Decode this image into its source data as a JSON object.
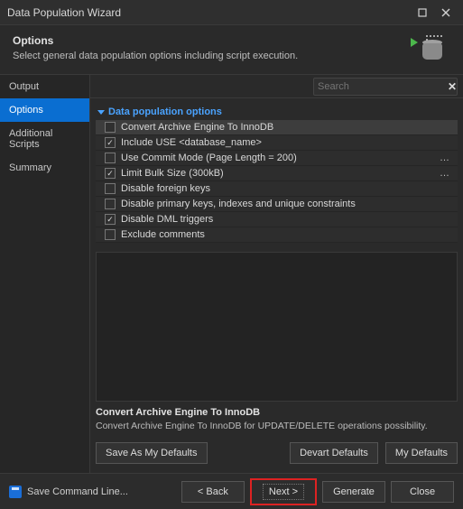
{
  "title": "Data Population Wizard",
  "header": {
    "title": "Options",
    "subtitle": "Select general data population options including script execution."
  },
  "sidebar": {
    "items": [
      {
        "label": "Output"
      },
      {
        "label": "Options"
      },
      {
        "label": "Additional Scripts"
      },
      {
        "label": "Summary"
      }
    ]
  },
  "search": {
    "placeholder": "Search"
  },
  "section_title": "Data population options",
  "options": [
    {
      "label": "Convert Archive Engine To InnoDB",
      "checked": false,
      "highlight": true,
      "ellipsis": false
    },
    {
      "label": "Include USE <database_name>",
      "checked": true,
      "highlight": false,
      "ellipsis": false
    },
    {
      "label": "Use Commit Mode (Page Length = 200)",
      "checked": false,
      "highlight": false,
      "ellipsis": true
    },
    {
      "label": "Limit Bulk Size (300kB)",
      "checked": true,
      "highlight": false,
      "ellipsis": true
    },
    {
      "label": "Disable foreign keys",
      "checked": false,
      "highlight": false,
      "ellipsis": false
    },
    {
      "label": "Disable primary keys, indexes and unique constraints",
      "checked": false,
      "highlight": false,
      "ellipsis": false
    },
    {
      "label": "Disable DML triggers",
      "checked": true,
      "highlight": false,
      "ellipsis": false
    },
    {
      "label": "Exclude comments",
      "checked": false,
      "highlight": false,
      "ellipsis": false
    }
  ],
  "description": {
    "title": "Convert Archive Engine To InnoDB",
    "body": "Convert Archive Engine To InnoDB for UPDATE/DELETE operations possibility."
  },
  "defaults": {
    "save_as": "Save As My Defaults",
    "devart": "Devart Defaults",
    "my": "My Defaults"
  },
  "footer": {
    "save_cmd": "Save Command Line...",
    "back": "< Back",
    "next": "Next >",
    "generate": "Generate",
    "close": "Close"
  }
}
